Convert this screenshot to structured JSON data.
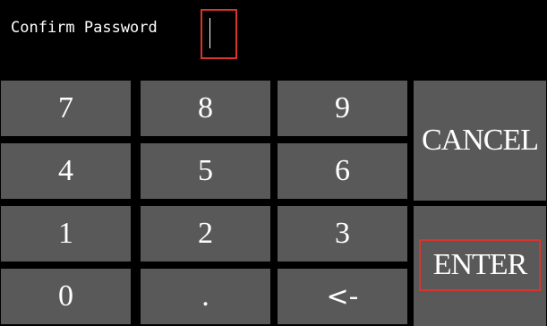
{
  "header": {
    "prompt_label": "Confirm Password",
    "field_value": ""
  },
  "keypad": {
    "rows": [
      [
        "7",
        "8",
        "9"
      ],
      [
        "4",
        "5",
        "6"
      ],
      [
        "1",
        "2",
        "3"
      ],
      [
        "0",
        ".",
        "<-"
      ]
    ],
    "cancel_label": "CANCEL",
    "enter_label": "ENTER"
  },
  "colors": {
    "background": "#000000",
    "key": "#595959",
    "key_text": "#ffffff",
    "highlight": "#d9342b"
  }
}
